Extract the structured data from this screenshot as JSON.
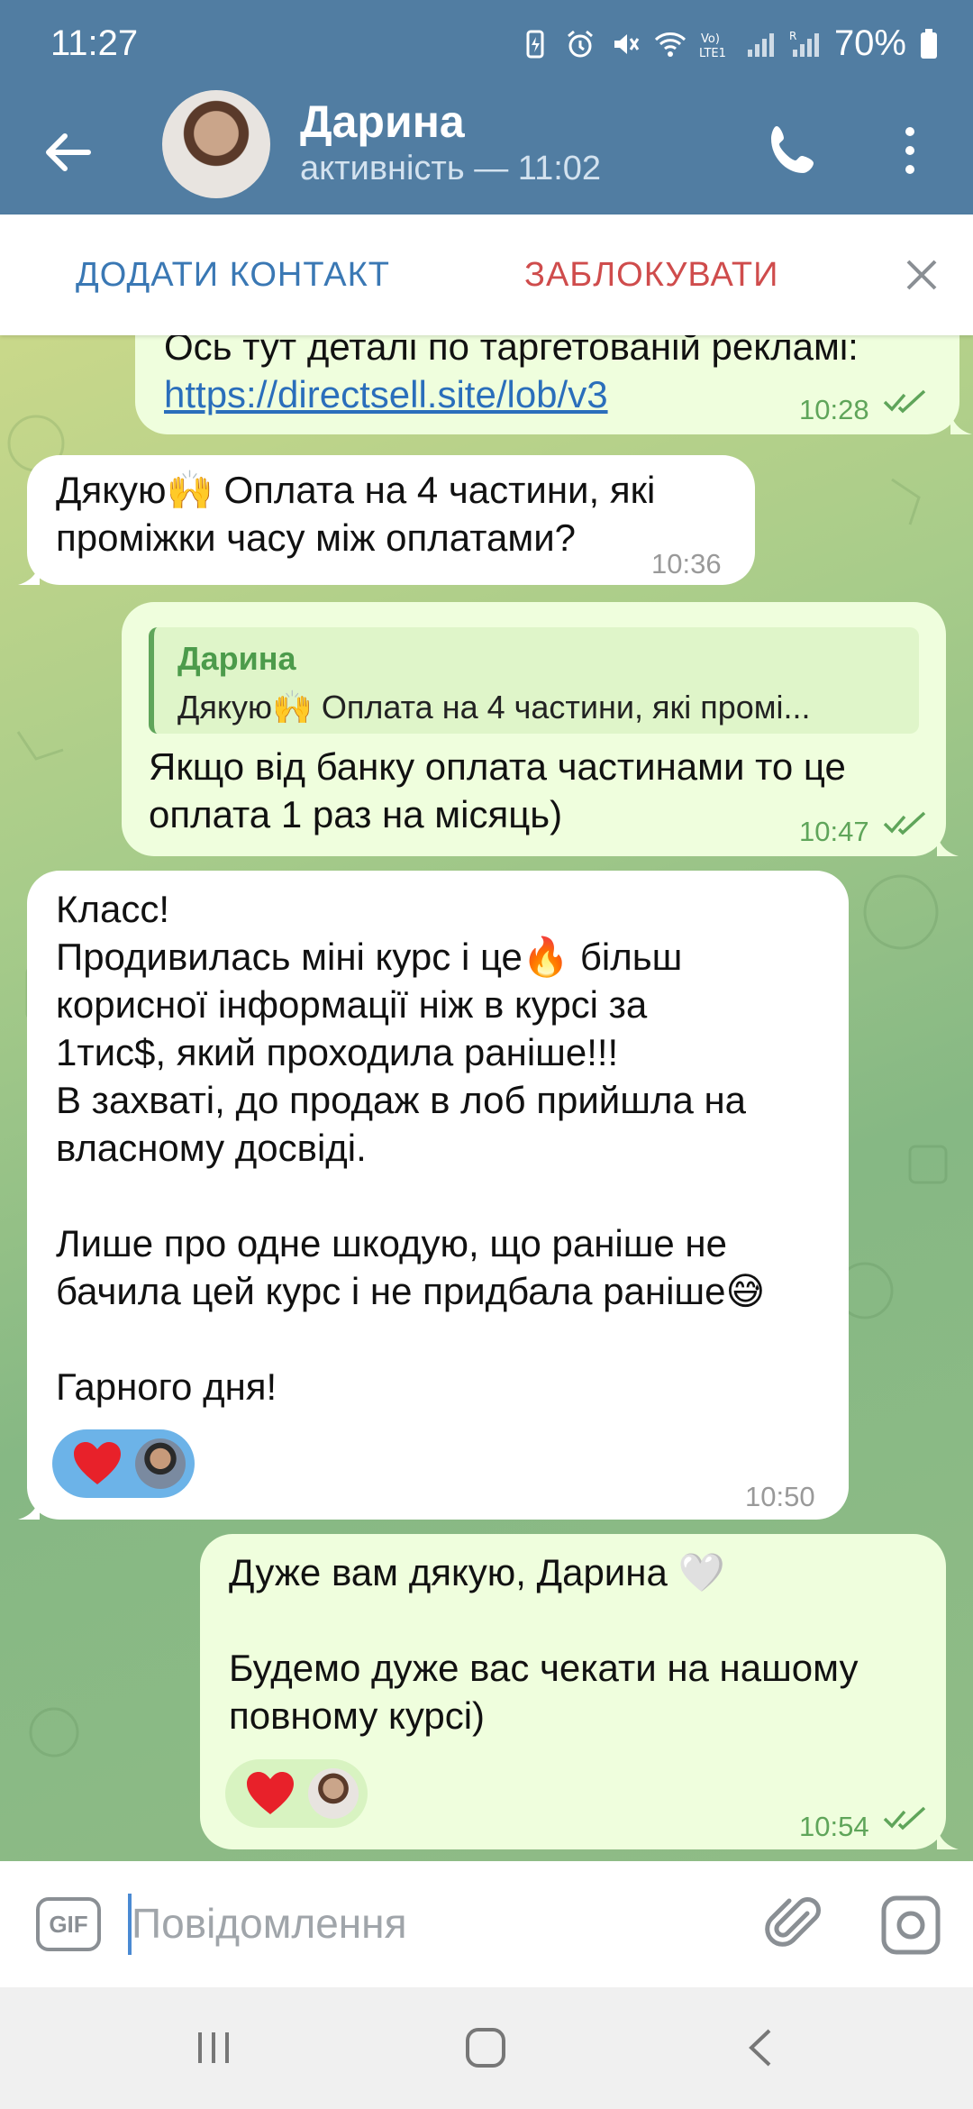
{
  "status_bar": {
    "time": "11:27",
    "battery": "70%"
  },
  "header": {
    "name": "Дарина",
    "last_seen": "активність — 11:02"
  },
  "action_bar": {
    "add_contact": "ДОДАТИ КОНТАКТ",
    "block": "ЗАБЛОКУВАТИ"
  },
  "messages": [
    {
      "direction": "outgoing",
      "line1": "Ось тут деталі по таргетованій рекламі:",
      "link": "https://directsell.site/lob/v3",
      "time": "10:28"
    },
    {
      "direction": "incoming",
      "line1": "Дякую🙌 Оплата на 4 частини, які",
      "line2": "проміжки часу між оплатами?",
      "time": "10:36"
    },
    {
      "direction": "outgoing",
      "quote_name": "Дарина",
      "quote_text": "Дякую🙌 Оплата на 4 частини, які промі...",
      "line1": "Якщо від банку оплата частинами то це",
      "line2": "оплата 1 раз на місяць)",
      "time": "10:47"
    },
    {
      "direction": "incoming",
      "lines": [
        "Класс!",
        "Продивилась міні курс і це🔥 більш",
        "корисної інформації ніж в курсі за",
        "1тис$, який проходила раніше!!!",
        "В захваті, до продаж в лоб прийшла на",
        "власному досвіді.",
        "",
        "Лише про одне шкодую, що раніше не",
        "бачила цей курс і не придбала раніше😅",
        "",
        "Гарного дня!"
      ],
      "time": "10:50"
    },
    {
      "direction": "outgoing",
      "lines": [
        "Дуже вам дякую, Дарина 🤍",
        "",
        "Будемо дуже вас чекати на нашому",
        "повному курсі)"
      ],
      "time": "10:54"
    }
  ],
  "input": {
    "gif_label": "GIF",
    "placeholder": "Повідомлення"
  },
  "colors": {
    "header": "#517da2",
    "outgoing_bubble": "#effedd",
    "incoming_bubble": "#ffffff",
    "block_red": "#cf4c4c",
    "accent_blue": "#3a78b4"
  },
  "icons": [
    "back-arrow-icon",
    "phone-icon",
    "more-vert-icon",
    "close-icon",
    "double-check-icon",
    "heart-icon",
    "gif-icon",
    "paperclip-icon",
    "camera-icon",
    "recent-apps-icon",
    "home-icon",
    "nav-back-icon"
  ]
}
